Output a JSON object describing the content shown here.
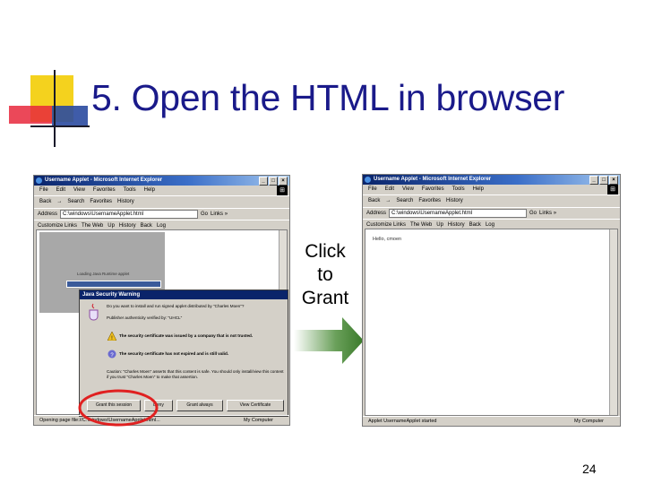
{
  "slide": {
    "title": "5. Open the HTML in browser",
    "callout": [
      "Click",
      "to",
      "Grant"
    ],
    "page_number": "24"
  },
  "left_window": {
    "title": "Username Applet - Microsoft Internet Explorer",
    "menu": [
      "File",
      "Edit",
      "View",
      "Favorites",
      "Tools",
      "Help"
    ],
    "toolbar": [
      "Back",
      "→",
      "Search",
      "Favorites",
      "History"
    ],
    "address_label": "Address",
    "address": "C:\\windows\\UsernameApplet.html",
    "go_label": "Go",
    "links_label": "Links »",
    "links": [
      "Customize Links",
      "The Web",
      "Up",
      "History",
      "Back",
      "Log"
    ],
    "loading_text": "Loading Java Runtime applet",
    "status": "Opening page file://C:\\windows\\UsernameApplet.html...",
    "status_zone": "My Computer",
    "dialog": {
      "title": "Java Security Warning",
      "intro": "Do you want to install and run signed applet distributed by \"Charles Moen\"?",
      "publisher": "Publisher authenticity verified by: \"UHCL\"",
      "warning1": "The security certificate was issued by a company that is not trusted.",
      "warning2": "The security certificate has not expired and is still valid.",
      "caution": "Caution: \"Charles Moen\" asserts that this content is safe. You should only install/view this content if you trust \"Charles Moen\" to make that assertion.",
      "buttons": [
        "Grant this session",
        "Deny",
        "Grant always",
        "View Certificate"
      ]
    }
  },
  "right_window": {
    "title": "Username Applet - Microsoft Internet Explorer",
    "menu": [
      "File",
      "Edit",
      "View",
      "Favorites",
      "Tools",
      "Help"
    ],
    "toolbar": [
      "Back",
      "→",
      "Search",
      "Favorites",
      "History"
    ],
    "address_label": "Address",
    "address": "C:\\windows\\UsernameApplet.html",
    "go_label": "Go",
    "links_label": "Links »",
    "links": [
      "Customize Links",
      "The Web",
      "Up",
      "History",
      "Back",
      "Log"
    ],
    "content_text": "Hello, cmoen",
    "status": "Applet UsernameApplet started",
    "status_zone": "My Computer"
  },
  "colors": {
    "title": "#1a1a8a",
    "arrow": "#4a8a3a",
    "highlight_circle": "#e02020",
    "deco_yellow": "#f4d21e",
    "deco_red": "#e8283c",
    "deco_blue": "#2a4aa0"
  }
}
